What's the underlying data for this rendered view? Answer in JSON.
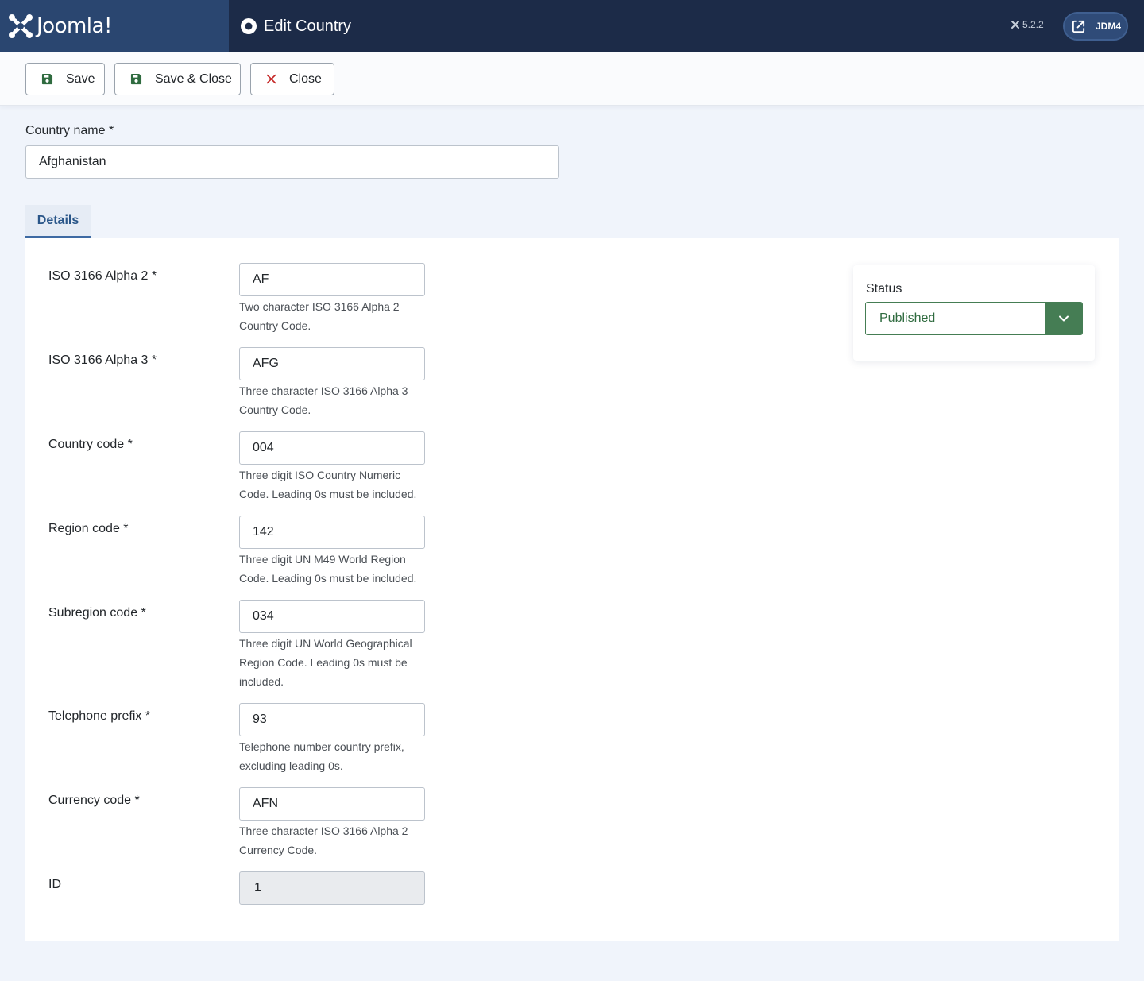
{
  "header": {
    "logo_text": "Joomla!",
    "page_title": "Edit Country",
    "version": "5.2.2",
    "site_label": "JDM4"
  },
  "toolbar": {
    "save_label": "Save",
    "save_close_label": "Save & Close",
    "close_label": "Close"
  },
  "form": {
    "country_name_label": "Country name *",
    "country_name_value": "Afghanistan",
    "tab_details": "Details",
    "fields": [
      {
        "label": "ISO 3166 Alpha 2 *",
        "value": "AF",
        "desc_line1": "Two character ISO 3166 Alpha 2",
        "desc_line2": "Country Code.",
        "desc_line3": ""
      },
      {
        "label": "ISO 3166 Alpha 3 *",
        "value": "AFG",
        "desc_line1": "Three character ISO 3166 Alpha 3",
        "desc_line2": "Country Code.",
        "desc_line3": ""
      },
      {
        "label": "Country code *",
        "value": "004",
        "desc_line1": "Three digit ISO Country Numeric",
        "desc_line2": "Code. Leading 0s must be included.",
        "desc_line3": ""
      },
      {
        "label": "Region code *",
        "value": "142",
        "desc_line1": "Three digit UN M49 World Region",
        "desc_line2": "Code. Leading 0s must be included.",
        "desc_line3": ""
      },
      {
        "label": "Subregion code *",
        "value": "034",
        "desc_line1": "Three digit UN World Geographical",
        "desc_line2": "Region Code. Leading 0s must be",
        "desc_line3": "included."
      },
      {
        "label": "Telephone prefix *",
        "value": "93",
        "desc_line1": "Telephone number country prefix,",
        "desc_line2": "excluding leading 0s.",
        "desc_line3": ""
      },
      {
        "label": "Currency code *",
        "value": "AFN",
        "desc_line1": "Three character ISO 3166 Alpha 2",
        "desc_line2": "Currency Code.",
        "desc_line3": ""
      },
      {
        "label": "ID",
        "value": "1"
      }
    ],
    "status_label": "Status",
    "status_value": "Published"
  },
  "colors": {
    "header_bg": "#1c2b48",
    "logo_bg": "#2a4670",
    "save_icon": "#2f6b3f",
    "close_icon": "#c52827",
    "status_green": "#457d54",
    "tab_accent": "#3e6aa3"
  },
  "icons": {
    "logo": "joomla-logo-icon",
    "title": "circle-dot-icon",
    "version": "joomla-small-icon",
    "site": "external-link-icon",
    "save": "floppy-disk-icon",
    "close": "x-icon",
    "status_arrow": "chevron-down-icon"
  }
}
